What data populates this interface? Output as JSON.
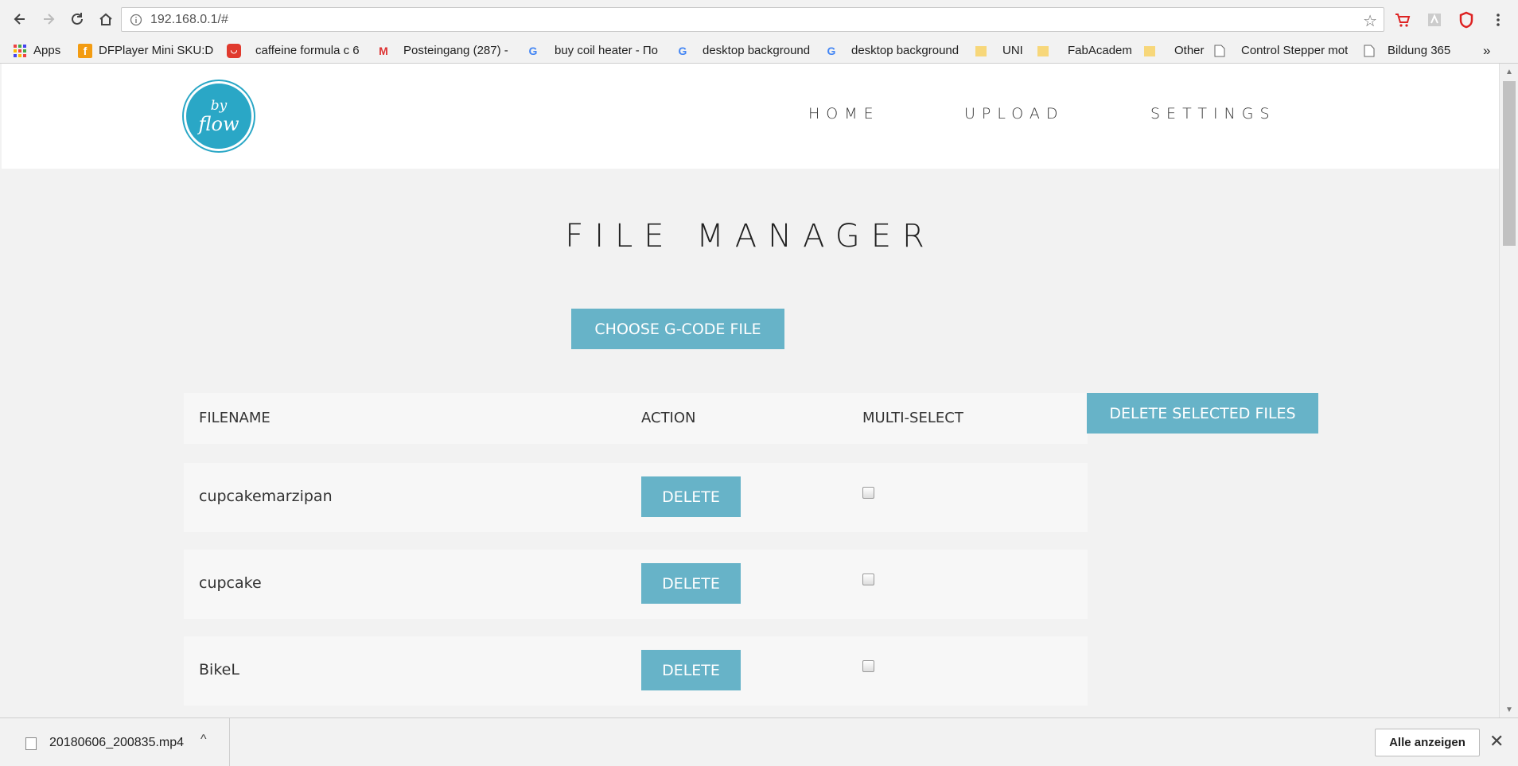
{
  "browser": {
    "url": "192.168.0.1/#",
    "bookmarks": [
      {
        "label": "Apps",
        "icon": "apps-grid-icon"
      },
      {
        "label": "DFPlayer Mini SKU:D",
        "icon": "dfrobot-icon"
      },
      {
        "label": "caffeine formula c 6",
        "icon": "site-icon"
      },
      {
        "label": "Posteingang (287) - ",
        "icon": "gmail-icon"
      },
      {
        "label": "buy coil heater - По",
        "icon": "google-icon"
      },
      {
        "label": "desktop background",
        "icon": "google-icon"
      },
      {
        "label": "desktop background",
        "icon": "google-icon"
      },
      {
        "label": "UNI",
        "icon": "folder-icon"
      },
      {
        "label": "FabAcademy",
        "icon": "folder-icon"
      },
      {
        "label": "Other",
        "icon": "folder-icon"
      },
      {
        "label": "Control Stepper mot",
        "icon": "page-icon"
      },
      {
        "label": "Bildung 365",
        "icon": "page-icon"
      }
    ],
    "overflow": "»"
  },
  "site": {
    "logo_line1": "by",
    "logo_line2": "flow",
    "nav": [
      "HOME",
      "UPLOAD",
      "SETTINGS"
    ]
  },
  "main": {
    "title": "FILE MANAGER",
    "choose_button": "CHOOSE G-CODE FILE",
    "delete_selected_button": "DELETE SELECTED FILES",
    "columns": [
      "FILENAME",
      "ACTION",
      "MULTI-SELECT"
    ],
    "delete_label": "DELETE",
    "files": [
      {
        "name": "cupcakemarzipan",
        "checked": false
      },
      {
        "name": "cupcake",
        "checked": false
      },
      {
        "name": "BikeL",
        "checked": false
      }
    ]
  },
  "downloads": {
    "file": "20180606_200835.mp4",
    "show_all": "Alle anzeigen"
  },
  "colors": {
    "accent": "#67b3c8",
    "logo": "#2aa7c6"
  }
}
